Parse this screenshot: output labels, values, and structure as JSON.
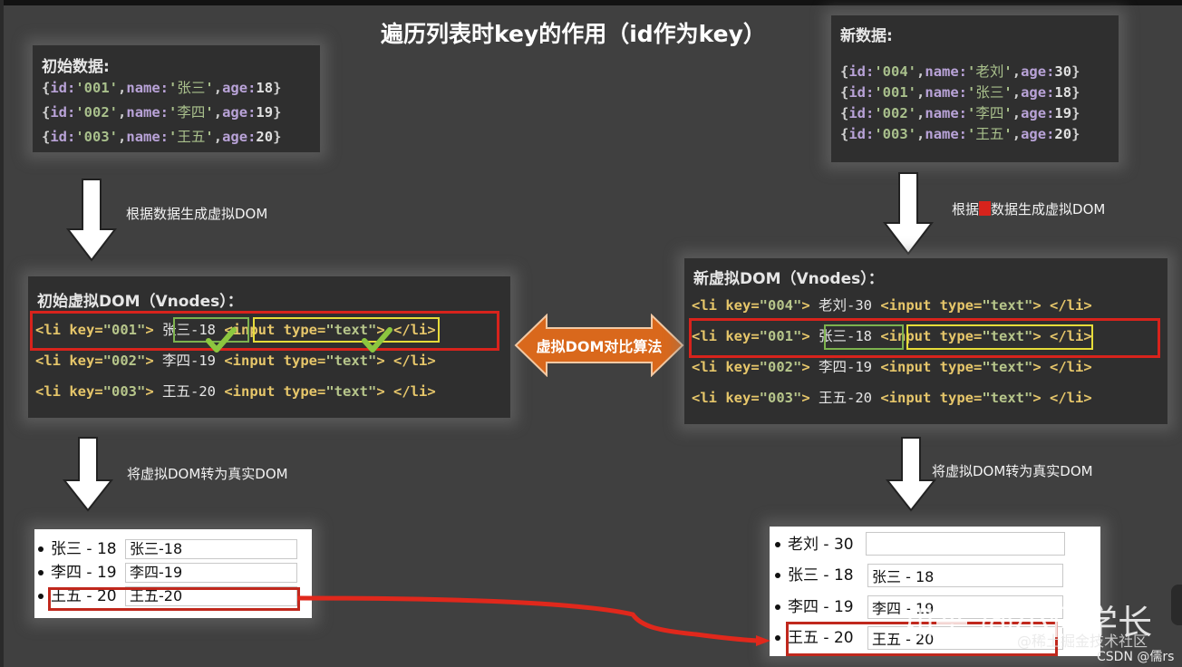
{
  "title": "遍历列表时key的作用（id作为key）",
  "initial_data": {
    "heading": "初始数据:",
    "rows": [
      {
        "id": "001",
        "name": "张三",
        "age": "18"
      },
      {
        "id": "002",
        "name": "李四",
        "age": "19"
      },
      {
        "id": "003",
        "name": "王五",
        "age": "20"
      }
    ]
  },
  "new_data": {
    "heading": "新数据:",
    "rows": [
      {
        "id": "004",
        "name": "老刘",
        "age": "30"
      },
      {
        "id": "001",
        "name": "张三",
        "age": "18"
      },
      {
        "id": "002",
        "name": "李四",
        "age": "19"
      },
      {
        "id": "003",
        "name": "王五",
        "age": "20"
      }
    ]
  },
  "labels": {
    "gen_vdom_left": "根据数据生成虚拟DOM",
    "gen_vdom_right_pre": "根据",
    "gen_vdom_right_post": "数据生成虚拟DOM",
    "to_real_left": "将虚拟DOM转为真实DOM",
    "to_real_right": "将虚拟DOM转为真实DOM",
    "diff_algorithm": "虚拟DOM对比算法"
  },
  "initial_vdom": {
    "heading": "初始虚拟DOM（Vnodes）：",
    "rows": [
      {
        "key": "001",
        "text": "张三-18",
        "highlighted": true
      },
      {
        "key": "002",
        "text": "李四-19",
        "highlighted": false
      },
      {
        "key": "003",
        "text": "王五-20",
        "highlighted": false
      }
    ]
  },
  "new_vdom": {
    "heading": "新虚拟DOM（Vnodes）：",
    "rows": [
      {
        "key": "004",
        "text": "老刘-30",
        "highlighted": false
      },
      {
        "key": "001",
        "text": "张三-18",
        "highlighted": true
      },
      {
        "key": "002",
        "text": "李四-19",
        "highlighted": false
      },
      {
        "key": "003",
        "text": "王五-20",
        "highlighted": false
      }
    ]
  },
  "code": {
    "li_open": "<li ",
    "key_attr": "key=",
    "tag_close": ">",
    "input_open": "<input ",
    "type_attr": "type=",
    "type_val": "\"text\"",
    "input_close": ">",
    "li_close": "</li>"
  },
  "initial_real_dom": [
    {
      "label": "张三 - 18",
      "input_value": "张三-18"
    },
    {
      "label": "李四 - 19",
      "input_value": "李四-19"
    },
    {
      "label": "王五 - 20",
      "input_value": "王五-20"
    }
  ],
  "new_real_dom": [
    {
      "label": "老刘 - 30",
      "input_value": ""
    },
    {
      "label": "张三 - 18",
      "input_value": "张三 - 18"
    },
    {
      "label": "李四 - 19",
      "input_value": "李四 - 19"
    },
    {
      "label": "王五 - 20",
      "input_value": "王五 - 20"
    }
  ],
  "watermarks": {
    "zhihu": "知乎 @小怪学长",
    "juejin": "@稀土掘金技术社区",
    "csdn": "CSDN @儒rs"
  },
  "colors": {
    "background": "#404040",
    "panel": "#2f2f2f",
    "highlight_red": "#d8231c",
    "green_box": "#7db24e",
    "yellow_box": "#e6dc3a",
    "diff_arrow": "#d9681c",
    "checkmark": "#8cc63f"
  }
}
